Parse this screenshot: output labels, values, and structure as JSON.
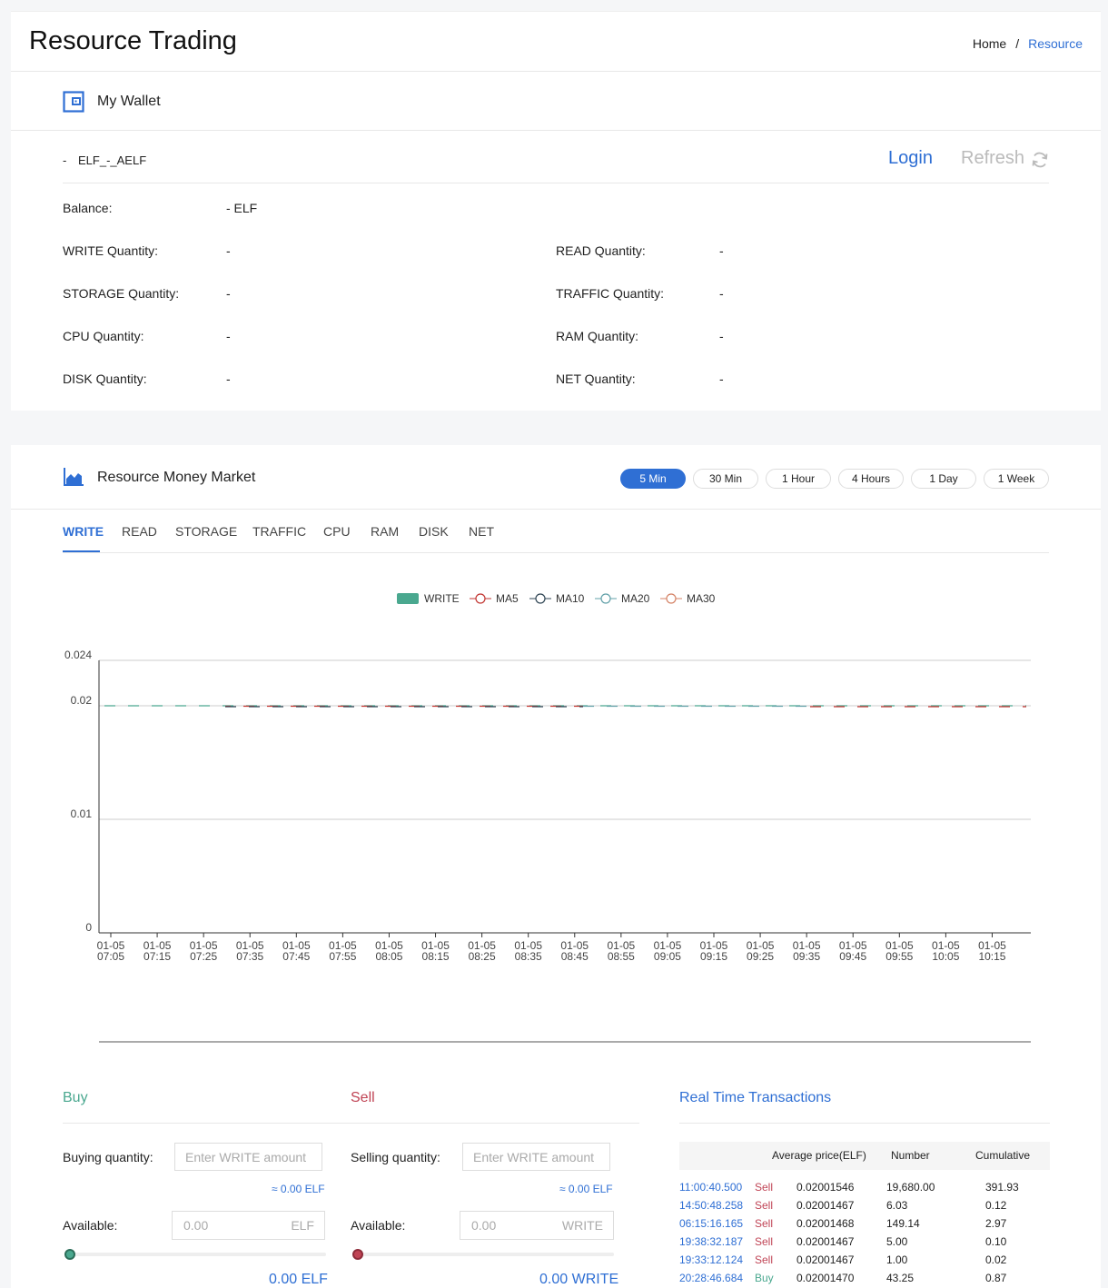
{
  "header": {
    "title": "Resource Trading",
    "breadcrumb": {
      "home": "Home",
      "separator": "/",
      "current": "Resource"
    }
  },
  "wallet": {
    "title": "My Wallet",
    "account_dash": "-",
    "account_name": "ELF_-_AELF",
    "login_label": "Login",
    "refresh_label": "Refresh",
    "balance_label": "Balance:",
    "balance_value": "- ELF",
    "quantities": [
      {
        "label": "WRITE Quantity:",
        "value": "-"
      },
      {
        "label": "READ Quantity:",
        "value": "-"
      },
      {
        "label": "STORAGE Quantity:",
        "value": "-"
      },
      {
        "label": "TRAFFIC Quantity:",
        "value": "-"
      },
      {
        "label": "CPU Quantity:",
        "value": "-"
      },
      {
        "label": "RAM Quantity:",
        "value": "-"
      },
      {
        "label": "DISK Quantity:",
        "value": "-"
      },
      {
        "label": "NET Quantity:",
        "value": "-"
      }
    ]
  },
  "market": {
    "title": "Resource Money Market",
    "intervals": [
      "5 Min",
      "30 Min",
      "1 Hour",
      "4 Hours",
      "1 Day",
      "1 Week"
    ],
    "active_interval": "5 Min",
    "tabs": [
      "WRITE",
      "READ",
      "STORAGE",
      "TRAFFIC",
      "CPU",
      "RAM",
      "DISK",
      "NET"
    ],
    "active_tab": "WRITE"
  },
  "chart_data": {
    "type": "line",
    "legend": [
      {
        "name": "WRITE",
        "color": "#4aa88f"
      },
      {
        "name": "MA5",
        "color": "#c23531"
      },
      {
        "name": "MA10",
        "color": "#2f4554"
      },
      {
        "name": "MA20",
        "color": "#61a0a8"
      },
      {
        "name": "MA30",
        "color": "#d48265"
      }
    ],
    "y_ticks": [
      "0.024",
      "0.02",
      "0.01",
      "0"
    ],
    "ylim": [
      0,
      0.024
    ],
    "x_ticks": [
      [
        "01-05",
        "07:05"
      ],
      [
        "01-05",
        "07:15"
      ],
      [
        "01-05",
        "07:25"
      ],
      [
        "01-05",
        "07:35"
      ],
      [
        "01-05",
        "07:45"
      ],
      [
        "01-05",
        "07:55"
      ],
      [
        "01-05",
        "08:05"
      ],
      [
        "01-05",
        "08:15"
      ],
      [
        "01-05",
        "08:25"
      ],
      [
        "01-05",
        "08:35"
      ],
      [
        "01-05",
        "08:45"
      ],
      [
        "01-05",
        "08:55"
      ],
      [
        "01-05",
        "09:05"
      ],
      [
        "01-05",
        "09:15"
      ],
      [
        "01-05",
        "09:25"
      ],
      [
        "01-05",
        "09:35"
      ],
      [
        "01-05",
        "09:45"
      ],
      [
        "01-05",
        "09:55"
      ],
      [
        "01-05",
        "10:05"
      ],
      [
        "01-05",
        "10:15"
      ]
    ],
    "series_value": 0.02
  },
  "buy": {
    "title": "Buy",
    "qty_label": "Buying quantity:",
    "qty_placeholder": "Enter WRITE amount",
    "approx": "≈ 0.00 ELF",
    "available_label": "Available:",
    "available_value": "0.00",
    "available_unit": "ELF",
    "total": "0.00 ELF",
    "slider_fraction": 0
  },
  "sell": {
    "title": "Sell",
    "qty_label": "Selling quantity:",
    "qty_placeholder": "Enter WRITE amount",
    "approx": "≈ 0.00 ELF",
    "available_label": "Available:",
    "available_value": "0.00",
    "available_unit": "WRITE",
    "total": "0.00 WRITE",
    "slider_fraction": 0
  },
  "transactions": {
    "title": "Real Time Transactions",
    "headers": [
      "Average price(ELF)",
      "Number",
      "Cumulative"
    ],
    "rows": [
      {
        "time": "11:00:40.500",
        "type": "Sell",
        "price": "0.02001546",
        "number": "19,680.00",
        "cumulative": "391.93"
      },
      {
        "time": "14:50:48.258",
        "type": "Sell",
        "price": "0.02001467",
        "number": "6.03",
        "cumulative": "0.12"
      },
      {
        "time": "06:15:16.165",
        "type": "Sell",
        "price": "0.02001468",
        "number": "149.14",
        "cumulative": "2.97"
      },
      {
        "time": "19:38:32.187",
        "type": "Sell",
        "price": "0.02001467",
        "number": "5.00",
        "cumulative": "0.10"
      },
      {
        "time": "19:33:12.124",
        "type": "Sell",
        "price": "0.02001467",
        "number": "1.00",
        "cumulative": "0.02"
      },
      {
        "time": "20:28:46.684",
        "type": "Buy",
        "price": "0.02001470",
        "number": "43.25",
        "cumulative": "0.87"
      }
    ]
  }
}
